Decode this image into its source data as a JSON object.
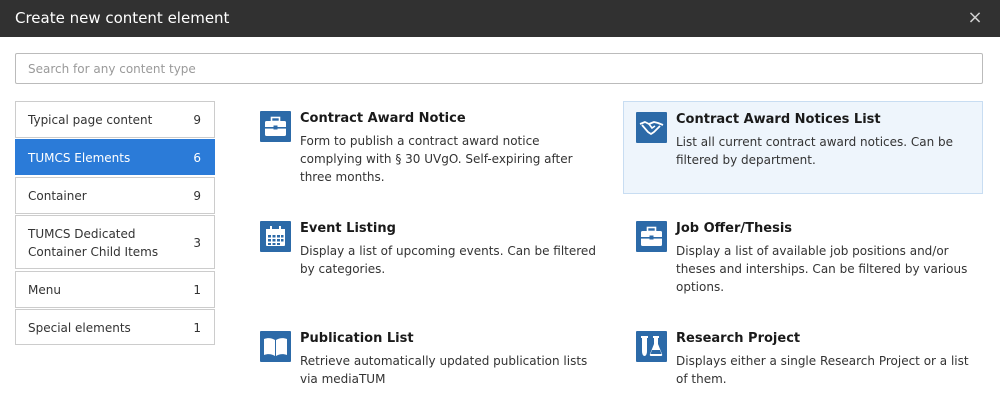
{
  "dialog": {
    "title": "Create new content element",
    "close": "×"
  },
  "search": {
    "placeholder": "Search for any content type"
  },
  "categories": [
    {
      "label": "Typical page content",
      "count": "9"
    },
    {
      "label": "TUMCS Elements",
      "count": "6"
    },
    {
      "label": "Container",
      "count": "9"
    },
    {
      "label": "TUMCS Dedicated Container Child Items",
      "count": "3"
    },
    {
      "label": "Menu",
      "count": "1"
    },
    {
      "label": "Special elements",
      "count": "1"
    }
  ],
  "active_category": "TUMCS Elements",
  "items": [
    {
      "title": "Contract Award Notice",
      "description": "Form to publish a contract award notice complying with § 30 UVgO. Self-expiring after three months.",
      "icon": "briefcase-icon"
    },
    {
      "title": "Contract Award Notices List",
      "description": "List all current contract award notices. Can be filtered by department.",
      "icon": "handshake-icon"
    },
    {
      "title": "Event Listing",
      "description": "Display a list of upcoming events. Can be filtered by categories.",
      "icon": "calendar-icon"
    },
    {
      "title": "Job Offer/Thesis",
      "description": "Display a list of available job positions and/or theses and interships. Can be filtered by various options.",
      "icon": "briefcase-icon"
    },
    {
      "title": "Publication List",
      "description": "Retrieve automatically updated publication lists via mediaTUM",
      "icon": "book-icon"
    },
    {
      "title": "Research Project",
      "description": "Displays either a single Research Project or a list of them.",
      "icon": "flask-icon"
    }
  ],
  "colors": {
    "header": "#313131",
    "active_category": "#2b7bd8",
    "icon_background": "#2c6aa8",
    "selected_item": "#eef5fc"
  }
}
